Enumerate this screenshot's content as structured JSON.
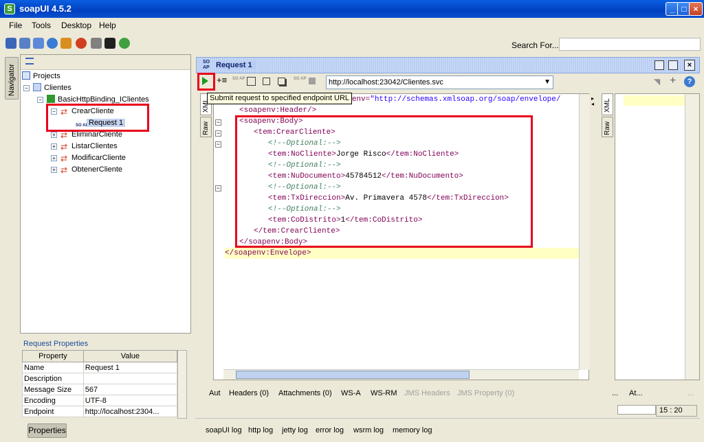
{
  "app": {
    "title": "soapUI 4.5.2",
    "icon": "soapui-logo-icon"
  },
  "window_controls": {
    "minimize": "_",
    "maximize": "□",
    "close": "×"
  },
  "menu": {
    "items": [
      "File",
      "Tools",
      "Desktop",
      "Help"
    ]
  },
  "search": {
    "label": "Search For...",
    "value": ""
  },
  "navigator": {
    "tab_label": "Navigator",
    "tree": {
      "root": "Projects",
      "project": "Clientes",
      "interface": "BasicHttpBinding_IClientes",
      "operations": [
        "CrearCliente",
        "EliminarCliente",
        "ListarClientes",
        "ModificarCliente",
        "ObtenerCliente"
      ],
      "request": "Request 1"
    }
  },
  "request_properties": {
    "title": "Request Properties",
    "columns": [
      "Property",
      "Value"
    ],
    "rows": [
      {
        "property": "Name",
        "value": "Request 1"
      },
      {
        "property": "Description",
        "value": ""
      },
      {
        "property": "Message Size",
        "value": "567"
      },
      {
        "property": "Encoding",
        "value": "UTF-8"
      },
      {
        "property": "Endpoint",
        "value": "http://localhost:2304..."
      }
    ],
    "button": "Properties"
  },
  "request_window": {
    "badge": "SO AP",
    "title": "Request 1",
    "endpoint": "http://localhost:23042/Clientes.svc",
    "tooltip": "Submit request to specified endpoint URL",
    "editor_tabs": [
      "XML",
      "Raw"
    ],
    "xml_lines": [
      {
        "indent": 0,
        "html": "<span class=\"tag\">&lt;soapenv:Envelope xmlns:soapenv=</span><span class=\"val\">\"http://schemas.xmlsoap.org/soap/envelope/</span>"
      },
      {
        "indent": 1,
        "html": "<span class=\"tag\">&lt;soapenv:Header/&gt;</span>"
      },
      {
        "indent": 1,
        "html": "<span class=\"tag\">&lt;soapenv:Body&gt;</span>"
      },
      {
        "indent": 2,
        "html": "<span class=\"tag\">&lt;tem:CrearCliente&gt;</span>"
      },
      {
        "indent": 3,
        "html": "<span class=\"com\">&lt;!--Optional:--&gt;</span>"
      },
      {
        "indent": 3,
        "html": "<span class=\"tag\">&lt;tem:NoCliente&gt;</span>Jorge Risco<span class=\"tag\">&lt;/tem:NoCliente&gt;</span>"
      },
      {
        "indent": 3,
        "html": "<span class=\"com\">&lt;!--Optional:--&gt;</span>"
      },
      {
        "indent": 3,
        "html": "<span class=\"tag\">&lt;tem:NuDocumento&gt;</span>45784512<span class=\"tag\">&lt;/tem:NuDocumento&gt;</span>"
      },
      {
        "indent": 3,
        "html": "<span class=\"com\">&lt;!--Optional:--&gt;</span>"
      },
      {
        "indent": 3,
        "html": "<span class=\"tag\">&lt;tem:TxDireccion&gt;</span>Av. Primavera 4578<span class=\"tag\">&lt;/tem:TxDireccion&gt;</span>"
      },
      {
        "indent": 3,
        "html": "<span class=\"com\">&lt;!--Optional:--&gt;</span>"
      },
      {
        "indent": 3,
        "html": "<span class=\"tag\">&lt;tem:CoDistrito&gt;</span>1<span class=\"tag\">&lt;/tem:CoDistrito&gt;</span>"
      },
      {
        "indent": 2,
        "html": "<span class=\"tag\">&lt;/tem:CrearCliente&gt;</span>"
      },
      {
        "indent": 1,
        "html": "<span class=\"tag\">&lt;/soapenv:Body&gt;</span>"
      },
      {
        "indent": 0,
        "html": "<span class=\"tag\">&lt;/soapenv:Envelope&gt;</span>"
      }
    ],
    "bottom_tabs": [
      "Aut",
      "Headers (0)",
      "Attachments (0)",
      "WS-A",
      "WS-RM",
      "JMS Headers",
      "JMS Property (0)"
    ],
    "response_tabs": [
      "XML",
      "Raw"
    ],
    "response_bottom_tabs": [
      "...",
      "At...",
      "..."
    ],
    "caret_position": "15 : 20"
  },
  "log_tabs": [
    "soapUI log",
    "http log",
    "jetty log",
    "error log",
    "wsrm log",
    "memory log"
  ],
  "colors": {
    "highlight": "#e8001b",
    "accent": "#0a50d0"
  }
}
